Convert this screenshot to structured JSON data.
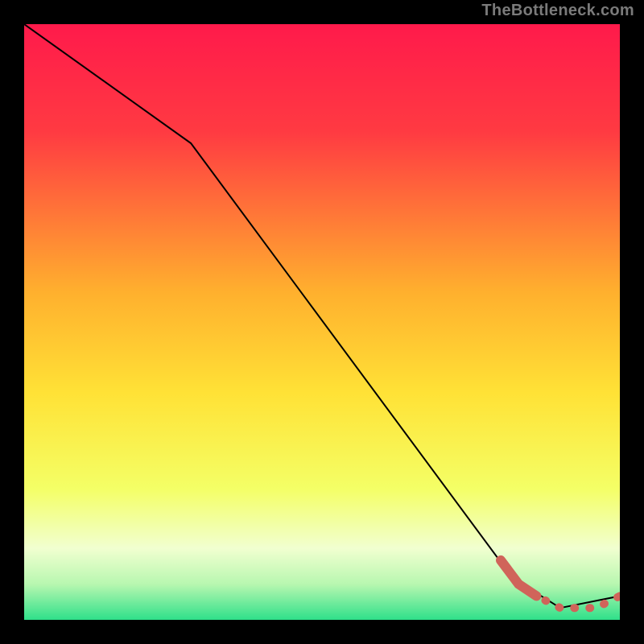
{
  "watermark": "TheBottleneck.com",
  "chart_data": {
    "type": "line",
    "title": "",
    "xlabel": "",
    "ylabel": "",
    "xlim": [
      0,
      100
    ],
    "ylim": [
      0,
      100
    ],
    "grid": false,
    "legend": false,
    "series": [
      {
        "name": "curve-main",
        "style": "solid",
        "color": "#000000",
        "x": [
          0,
          28,
          82,
          90,
          100
        ],
        "y": [
          100,
          80,
          7,
          2,
          4
        ]
      },
      {
        "name": "curve-highlight",
        "style": "dashed",
        "color": "#d0645a",
        "x": [
          80,
          83,
          86,
          88,
          90,
          93,
          96,
          100
        ],
        "y": [
          10,
          6,
          4,
          3,
          2,
          2,
          2,
          4
        ]
      }
    ],
    "background_gradient": [
      "#ff1a4b",
      "#ffe236",
      "#f7ffb3",
      "#37e08a"
    ]
  }
}
